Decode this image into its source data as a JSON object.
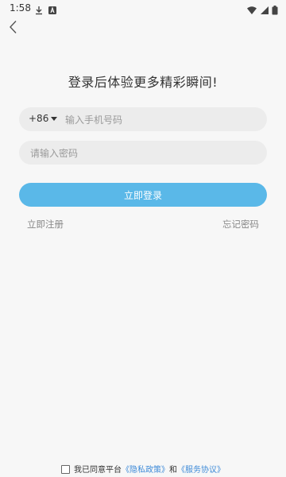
{
  "status_bar": {
    "time": "1:58",
    "left_icons": [
      "download-icon",
      "a-badge-icon"
    ],
    "right_icons": [
      "wifi-icon",
      "signal-icon",
      "battery-icon"
    ]
  },
  "header": {
    "back_icon": "back-chevron-icon"
  },
  "page": {
    "title": "登录后体验更多精彩瞬间!"
  },
  "form": {
    "country_code": "+86",
    "phone_placeholder": "输入手机号码",
    "phone_value": "",
    "password_placeholder": "请输入密码",
    "password_value": "",
    "login_label": "立即登录",
    "register_label": "立即注册",
    "forgot_label": "忘记密码"
  },
  "agreement": {
    "prefix": "我已同意平台",
    "privacy_label": "《隐私政策》",
    "conjunction": "和",
    "terms_label": "《服务协议》",
    "checked": false
  },
  "colors": {
    "accent": "#5ab8e8",
    "link": "#3f8bd8",
    "background": "#f7f7f7",
    "input_background": "#ececec"
  }
}
